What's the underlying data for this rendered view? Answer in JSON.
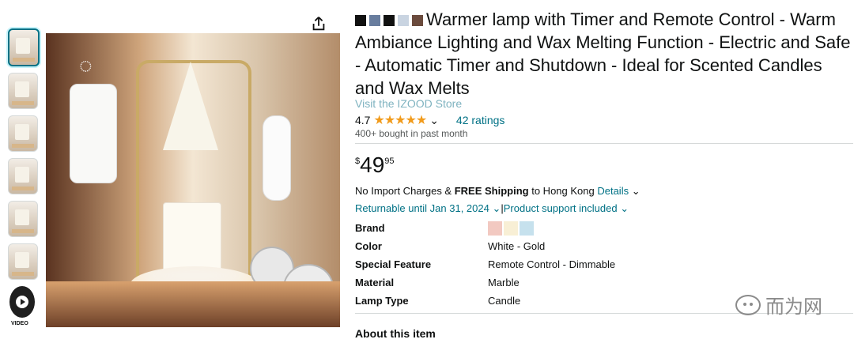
{
  "title": {
    "text": "Warmer lamp with Timer and Remote Control - Warm Ambiance Lighting and Wax Melting Function - Electric and Safe - Automatic Timer and Shutdown - Ideal for Scented Candles and Wax Melts"
  },
  "store": {
    "text": "Visit the IZOOD Store"
  },
  "rating": {
    "value": "4.7",
    "count": "42 ratings",
    "stars": "★★★★★"
  },
  "sales": {
    "bought": "400+ bought in past month"
  },
  "price": {
    "currency": "$",
    "whole": "49",
    "fraction": "95"
  },
  "shipping": {
    "prefix": "No Import Charges & ",
    "free": "FREE Shipping",
    "middle": " to Hong Kong ",
    "details": "Details"
  },
  "returns": {
    "until": "Returnable until Jan 31, 2024",
    "support": "Product support included"
  },
  "specs": [
    {
      "label": "Brand",
      "value": ""
    },
    {
      "label": "Color",
      "value": "White - Gold"
    },
    {
      "label": "Special Feature",
      "value": "Remote Control - Dimmable"
    },
    {
      "label": "Material",
      "value": "Marble"
    },
    {
      "label": "Lamp Type",
      "value": "Candle"
    }
  ],
  "about": {
    "heading": "About this item"
  },
  "watermark": {
    "text": "而为网"
  },
  "video": {
    "label": "VIDEO"
  },
  "colors": {
    "link": "#007185",
    "star": "#f19b1c",
    "text": "#0f1111",
    "muted": "#565959"
  }
}
